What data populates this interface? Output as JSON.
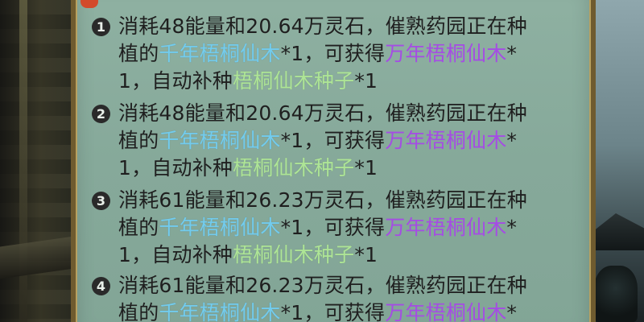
{
  "entries": [
    {
      "index": "1",
      "line1": "消耗48能量和20.64万灵石，催熟药园正在种",
      "line2_prefix": "植的",
      "source_item": "千年梧桐仙木",
      "line2_mid": "*1，可获得",
      "reward_item": "万年梧桐仙木",
      "line2_suffix": "*",
      "line3_prefix": "1，自动补种",
      "seed_item": "梧桐仙木种子",
      "line3_suffix": "*1"
    },
    {
      "index": "2",
      "line1": "消耗48能量和20.64万灵石，催熟药园正在种",
      "line2_prefix": "植的",
      "source_item": "千年梧桐仙木",
      "line2_mid": "*1，可获得",
      "reward_item": "万年梧桐仙木",
      "line2_suffix": "*",
      "line3_prefix": "1，自动补种",
      "seed_item": "梧桐仙木种子",
      "line3_suffix": "*1"
    },
    {
      "index": "3",
      "line1": "消耗61能量和26.23万灵石，催熟药园正在种",
      "line2_prefix": "植的",
      "source_item": "千年梧桐仙木",
      "line2_mid": "*1，可获得",
      "reward_item": "万年梧桐仙木",
      "line2_suffix": "*",
      "line3_prefix": "1，自动补种",
      "seed_item": "梧桐仙木种子",
      "line3_suffix": "*1"
    },
    {
      "index": "4",
      "line1": "消耗61能量和26.23万灵石，催熟药园正在种",
      "line2_prefix": "植的",
      "source_item": "千年梧桐仙木",
      "line2_mid": "*1，可获得",
      "reward_item": "万年梧桐仙木",
      "line2_suffix": "*"
    }
  ],
  "colors": {
    "panel": "#8fb1a2",
    "source_item": "#72ccee",
    "reward_item": "#a54ce4",
    "seed_item": "#aee596",
    "number_badge": "#2a2a2a"
  }
}
